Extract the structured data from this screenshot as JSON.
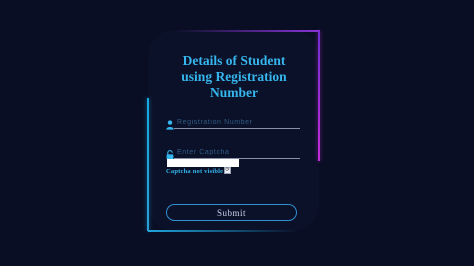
{
  "form": {
    "title": "Details of Student\nusing Registration\nNumber",
    "registration_placeholder": "Registration Number",
    "captcha_placeholder": "Enter Captcha",
    "captcha_image_text": "",
    "captcha_help": "Captcha not visible",
    "submit_label": "Submit"
  },
  "icons": {
    "registration": "user-icon",
    "captcha": "lock-icon",
    "refresh": "refresh-icon"
  },
  "colors": {
    "background": "#090e24",
    "accent_blue": "#36b6ee",
    "accent_purple": "#c42bd6"
  }
}
